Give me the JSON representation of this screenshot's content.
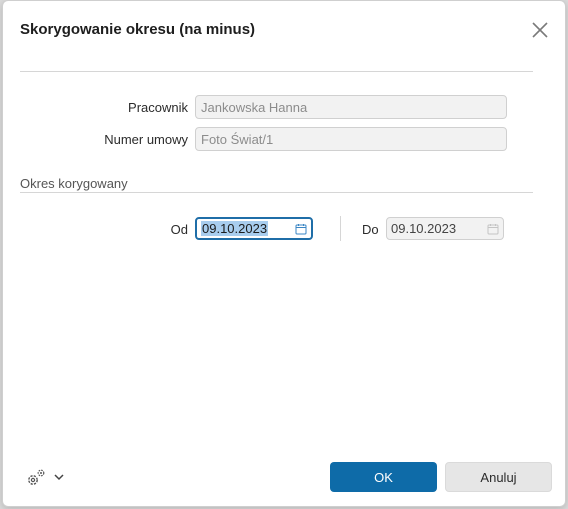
{
  "dialog": {
    "title": "Skorygowanie okresu (na minus)",
    "close_icon": "close-icon"
  },
  "fields": {
    "employee_label": "Pracownik",
    "employee_value": "Jankowska Hanna",
    "contract_label": "Numer umowy",
    "contract_value": "Foto Świat/1"
  },
  "period": {
    "section_label": "Okres korygowany",
    "from_label": "Od",
    "from_value": "09.10.2023",
    "to_label": "Do",
    "to_value": "09.10.2023",
    "calendar_icon": "calendar-icon"
  },
  "footer": {
    "settings_icon": "gear-icon",
    "dropdown_icon": "chevron-down-icon",
    "ok_label": "OK",
    "cancel_label": "Anuluj"
  },
  "colors": {
    "primary": "#0e6ba8",
    "focus_border": "#1f6ea8",
    "selection": "#a8cdee"
  }
}
